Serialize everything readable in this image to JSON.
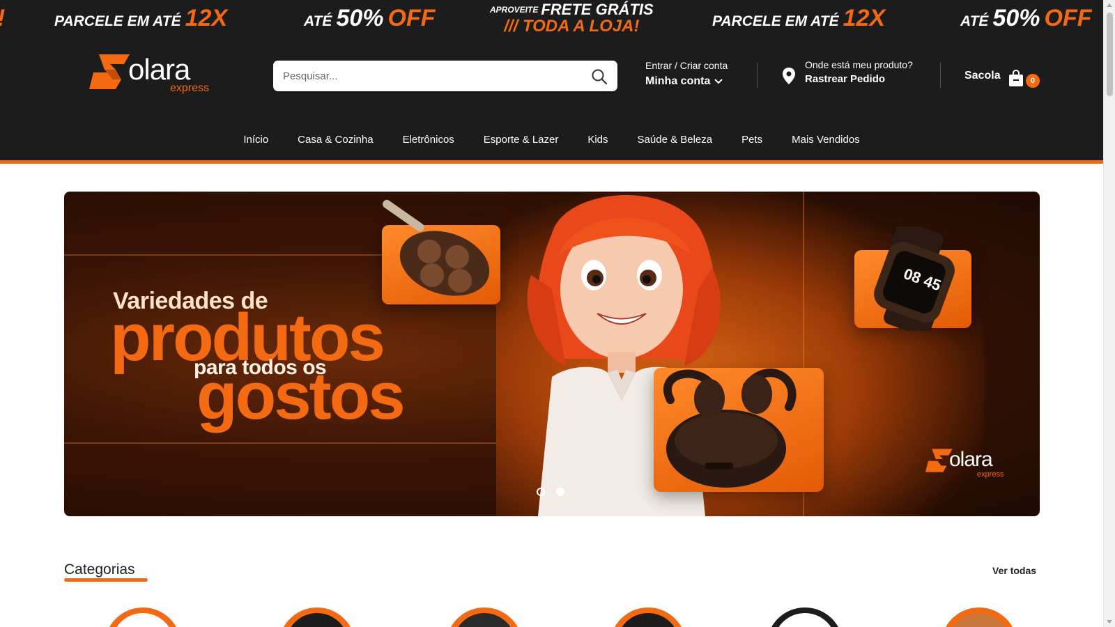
{
  "promo": {
    "items": [
      {
        "prefix": "PARCELE EM ATÉ",
        "highlight": "12X"
      },
      {
        "prefix": "ATÉ",
        "value": "50%",
        "highlight": "OFF"
      },
      {
        "prefix": "PARCELE EM ATÉ",
        "highlight": "12X"
      },
      {
        "prefix": "ATÉ",
        "value": "50%",
        "highlight": "OFF"
      }
    ],
    "frete": {
      "small": "APROVEITE",
      "title": "FRETE GRÁTIS",
      "subtitle": "/// TODA A LOJA!"
    },
    "left_fragment": "!"
  },
  "header": {
    "logo": {
      "name": "olara",
      "sub": "express"
    },
    "search": {
      "placeholder": "Pesquisar...",
      "value": ""
    },
    "account": {
      "line1": "Entrar / Criar conta",
      "line2": "Minha conta"
    },
    "track": {
      "line1": "Onde está meu produto?",
      "line2": "Rastrear Pedido"
    },
    "cart": {
      "label": "Sacola",
      "count": "0"
    }
  },
  "nav": {
    "items": [
      "Início",
      "Casa & Cozinha",
      "Eletrônicos",
      "Esporte & Lazer",
      "Kids",
      "Saúde & Beleza",
      "Pets",
      "Mais Vendidos"
    ]
  },
  "banner": {
    "line1": "Variedades de",
    "line2": "produtos",
    "line3": "para todos os",
    "line4": "gostos",
    "watch_time": "08 45",
    "logo": {
      "name": "olara",
      "sub": "express"
    },
    "slides": 2,
    "active_slide": 2
  },
  "categories": {
    "title": "Categorias",
    "see_all": "Ver todas"
  },
  "colors": {
    "accent": "#f46a12",
    "dark": "#1c1c1c"
  }
}
